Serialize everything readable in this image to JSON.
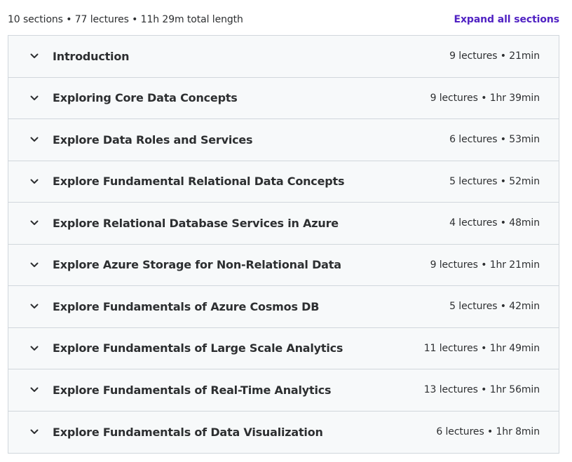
{
  "summary": {
    "text": "10 sections • 77 lectures • 11h 29m total length",
    "expand_label": "Expand all sections"
  },
  "accent_color": "#5022c3",
  "sections": [
    {
      "title": "Introduction",
      "meta": "9 lectures • 21min",
      "icon": "chevron-down-icon"
    },
    {
      "title": "Exploring Core Data Concepts",
      "meta": "9 lectures • 1hr 39min",
      "icon": "chevron-down-icon"
    },
    {
      "title": "Explore Data Roles and Services",
      "meta": "6 lectures • 53min",
      "icon": "chevron-down-icon"
    },
    {
      "title": "Explore Fundamental Relational Data Concepts",
      "meta": "5 lectures • 52min",
      "icon": "chevron-down-icon"
    },
    {
      "title": "Explore Relational Database Services in Azure",
      "meta": "4 lectures • 48min",
      "icon": "chevron-down-icon"
    },
    {
      "title": "Explore Azure Storage for Non-Relational Data",
      "meta": "9 lectures • 1hr 21min",
      "icon": "chevron-down-icon"
    },
    {
      "title": "Explore Fundamentals of Azure Cosmos DB",
      "meta": "5 lectures • 42min",
      "icon": "chevron-down-icon"
    },
    {
      "title": "Explore Fundamentals of Large Scale Analytics",
      "meta": "11 lectures • 1hr 49min",
      "icon": "chevron-down-icon"
    },
    {
      "title": "Explore Fundamentals of Real-Time Analytics",
      "meta": "13 lectures • 1hr 56min",
      "icon": "chevron-down-icon"
    },
    {
      "title": "Explore Fundamentals of Data Visualization",
      "meta": "6 lectures • 1hr 8min",
      "icon": "chevron-down-icon"
    }
  ]
}
